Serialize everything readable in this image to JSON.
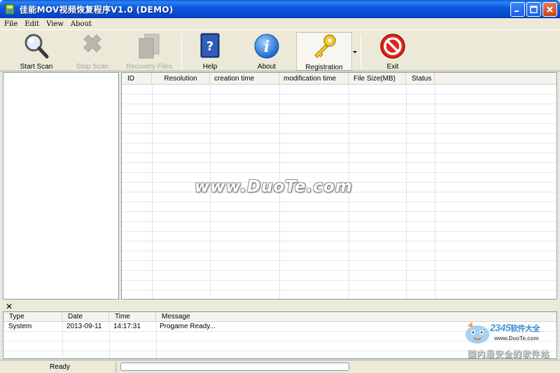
{
  "window": {
    "title": "佳能MOV视频恢复程序V1.0 (DEMO)",
    "titlebar_color": "#0a5ae0"
  },
  "menu": [
    {
      "label": "File"
    },
    {
      "label": "Edit"
    },
    {
      "label": "View"
    },
    {
      "label": "About"
    }
  ],
  "toolbar": {
    "start_scan": {
      "label": "Start Scan",
      "icon": "magnifier-icon",
      "enabled": true
    },
    "stop_scan": {
      "label": "Stop Scan",
      "icon": "stop-x-icon",
      "enabled": false
    },
    "recovery_files": {
      "label": "Recovery  Files",
      "icon": "files-icon",
      "enabled": false
    },
    "help": {
      "label": "Help",
      "icon": "help-book-icon",
      "enabled": true
    },
    "about": {
      "label": "About",
      "icon": "info-icon",
      "enabled": true
    },
    "registration": {
      "label": "Registration",
      "icon": "key-icon",
      "enabled": true,
      "pressed": true
    },
    "exit": {
      "label": "Exit",
      "icon": "no-entry-icon",
      "enabled": true
    }
  },
  "file_grid": {
    "columns": [
      "ID",
      "Resolution",
      "creation time",
      "modification time",
      "File Size(MB)",
      "Status"
    ],
    "rows": []
  },
  "watermark": "www.DuoTe.com",
  "log": {
    "columns": [
      "Type",
      "Date",
      "Time",
      "Message"
    ],
    "rows": [
      {
        "type": "System",
        "date": "2013-09-11",
        "time": "14:17:31",
        "message": "Progame Ready..."
      }
    ]
  },
  "status": {
    "text": "Ready",
    "progress": 0
  },
  "corner_logo": {
    "brand": "2345",
    "brand_cn": "软件大全",
    "url": "www.DuoTe.com",
    "slogan": "国内最安全的软件站"
  }
}
